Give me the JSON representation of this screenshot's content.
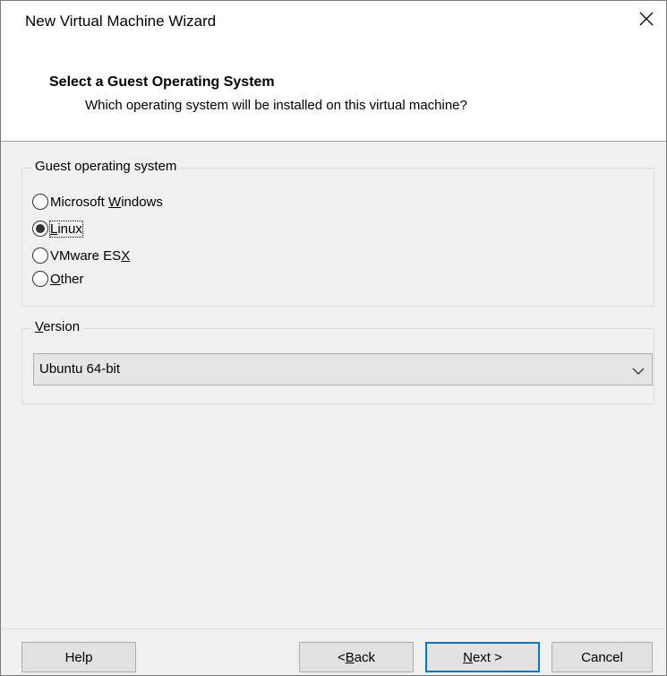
{
  "window": {
    "title": "New Virtual Machine Wizard",
    "close_icon": "close-icon"
  },
  "header": {
    "title": "Select a Guest Operating System",
    "subtitle": "Which operating system will be installed on this virtual machine?"
  },
  "guest_os": {
    "group_label": "Guest operating system",
    "options": [
      {
        "label": "Microsoft Windows",
        "mnemonic": "W",
        "checked": false
      },
      {
        "label": "Linux",
        "mnemonic": "L",
        "checked": true
      },
      {
        "label": "VMware ESX",
        "mnemonic": "X",
        "checked": false
      },
      {
        "label": "Other",
        "mnemonic": "O",
        "checked": false
      }
    ]
  },
  "version": {
    "group_label": "Version",
    "selected": "Ubuntu 64-bit"
  },
  "buttons": {
    "help": "Help",
    "back": "< Back",
    "next": "Next >",
    "cancel": "Cancel"
  },
  "colors": {
    "accent": "#0078d7"
  }
}
